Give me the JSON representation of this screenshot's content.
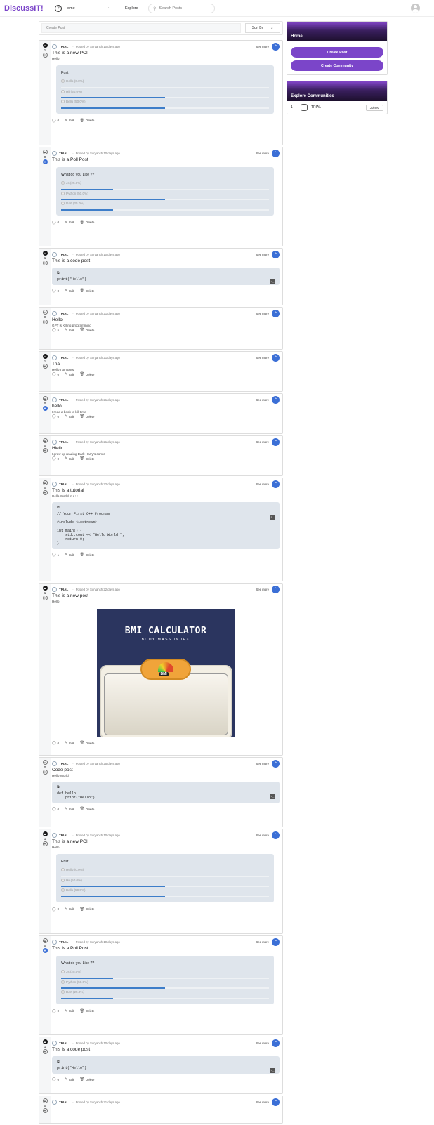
{
  "header": {
    "logo": "DiscussIT!",
    "home_label": "Home",
    "explore_label": "Explore",
    "search_placeholder": "Search Posts"
  },
  "feed": {
    "create_placeholder": "Create Post",
    "sort_label": "Sort By",
    "see_more": "See more",
    "edit_label": "Edit",
    "delete_label": "Delete",
    "posts": [
      {
        "votes": "1",
        "upvoted": true,
        "downvoted": false,
        "community": "TRIAL",
        "posted": "Posted by Suryansh 10 days ago",
        "title": "This is a new POll",
        "text": "Hello",
        "type": "poll",
        "poll_question": "Post",
        "poll_options": [
          {
            "label": "Hello  (0.0%)",
            "pct": 0
          },
          {
            "label": "Hii  (50.0%)",
            "pct": 50
          },
          {
            "label": "Bello  (50.0%)",
            "pct": 50
          }
        ],
        "comments": "0"
      },
      {
        "votes": "0",
        "upvoted": false,
        "downvoted": true,
        "community": "TRIAL",
        "posted": "Posted by Suryansh 10 days ago",
        "title": "This is a Poll Post",
        "text": "",
        "type": "poll",
        "poll_question": "What do you Like ??",
        "poll_options": [
          {
            "label": "Js  (25.0%)",
            "pct": 25
          },
          {
            "label": "Python  (50.0%)",
            "pct": 50
          },
          {
            "label": "Dart  (25.0%)",
            "pct": 25
          }
        ],
        "comments": "0"
      },
      {
        "votes": "1",
        "upvoted": true,
        "downvoted": false,
        "community": "TRIAL",
        "posted": "Posted by Suryansh 10 days ago",
        "title": "This is a code post",
        "text": "",
        "type": "code",
        "code": "print(\"Hello\")",
        "comments": "0"
      },
      {
        "votes": "0",
        "upvoted": false,
        "downvoted": false,
        "community": "TRIAL",
        "posted": "Posted by Suryansh 21 days ago",
        "title": "Hello",
        "text": "GPT is Killing programming",
        "type": "text",
        "comments": "5"
      },
      {
        "votes": "1",
        "upvoted": true,
        "downvoted": false,
        "community": "TRIAL",
        "posted": "Posted by Suryansh 21 days ago",
        "title": "Trial",
        "text": "Hello I am good",
        "type": "text",
        "comments": "0"
      },
      {
        "votes": "0",
        "upvoted": false,
        "downvoted": true,
        "community": "TRIAL",
        "posted": "Posted by Suryansh 21 days ago",
        "title": "hello",
        "text": "I read a book to kill time",
        "type": "text",
        "comments": "0"
      },
      {
        "votes": "0",
        "upvoted": false,
        "downvoted": false,
        "community": "TRIAL",
        "posted": "Posted by Suryansh 21 days ago",
        "title": "Hiello",
        "text": "I grew up reading Dark Harry's comic",
        "type": "text",
        "comments": "0"
      },
      {
        "votes": "0",
        "upvoted": false,
        "downvoted": false,
        "community": "TRIAL",
        "posted": "Posted by Suryansh 22 days ago",
        "title": "This is a tutorial",
        "text": "Hello World in c++",
        "type": "code",
        "code": "// Your First C++ Program\n\n#include <iostream>\n\nint main() {\n    std::cout << \"Hello World!\";\n    return 0;\n}",
        "comments": "1"
      },
      {
        "votes": "1",
        "upvoted": true,
        "downvoted": false,
        "community": "TRIAL",
        "posted": "Posted by Suryansh 22 days ago",
        "title": "This is a new post",
        "text": "Hello",
        "type": "image",
        "image_title": "BMI CALCULATOR",
        "image_subtitle": "BODY MASS INDEX",
        "comments": "0"
      },
      {
        "votes": "0",
        "upvoted": false,
        "downvoted": false,
        "community": "TRIAL",
        "posted": "Posted by Suryansh 25 days ago",
        "title": "Code post",
        "text": "Hello World",
        "type": "code",
        "code": "def hello:\n    print(\"Hello\")",
        "comments": "0"
      },
      {
        "votes": "1",
        "upvoted": true,
        "downvoted": false,
        "community": "TRIAL",
        "posted": "Posted by Suryansh 10 days ago",
        "title": "This is a new POll",
        "text": "Hello",
        "type": "poll",
        "poll_question": "Post",
        "poll_options": [
          {
            "label": "Hello  (0.0%)",
            "pct": 0
          },
          {
            "label": "Hii  (50.0%)",
            "pct": 50
          },
          {
            "label": "Bello  (50.0%)",
            "pct": 50
          }
        ],
        "comments": "0"
      },
      {
        "votes": "0",
        "upvoted": false,
        "downvoted": true,
        "community": "TRIAL",
        "posted": "Posted by Suryansh 10 days ago",
        "title": "This is a Poll Post",
        "text": "",
        "type": "poll",
        "poll_question": "What do you Like ??",
        "poll_options": [
          {
            "label": "Js  (25.0%)",
            "pct": 25
          },
          {
            "label": "Python  (50.0%)",
            "pct": 50
          },
          {
            "label": "Dart  (25.0%)",
            "pct": 25
          }
        ],
        "comments": "0"
      },
      {
        "votes": "1",
        "upvoted": true,
        "downvoted": false,
        "community": "TRIAL",
        "posted": "Posted by Suryansh 10 days ago",
        "title": "This is a code post",
        "text": "",
        "type": "code",
        "code": "print(\"Hello\")",
        "comments": "0"
      },
      {
        "votes": "0",
        "upvoted": false,
        "downvoted": false,
        "community": "TRIAL",
        "posted": "Posted by Suryansh 21 days ago",
        "title": "",
        "text": "",
        "type": "partial",
        "comments": ""
      }
    ]
  },
  "sidebar": {
    "home_title": "Home",
    "create_post_label": "Create Post",
    "create_community_label": "Create Community",
    "explore_title": "Explore Communities",
    "communities": [
      {
        "rank": "1",
        "name": "TRIAL",
        "status": "Joined"
      }
    ]
  }
}
